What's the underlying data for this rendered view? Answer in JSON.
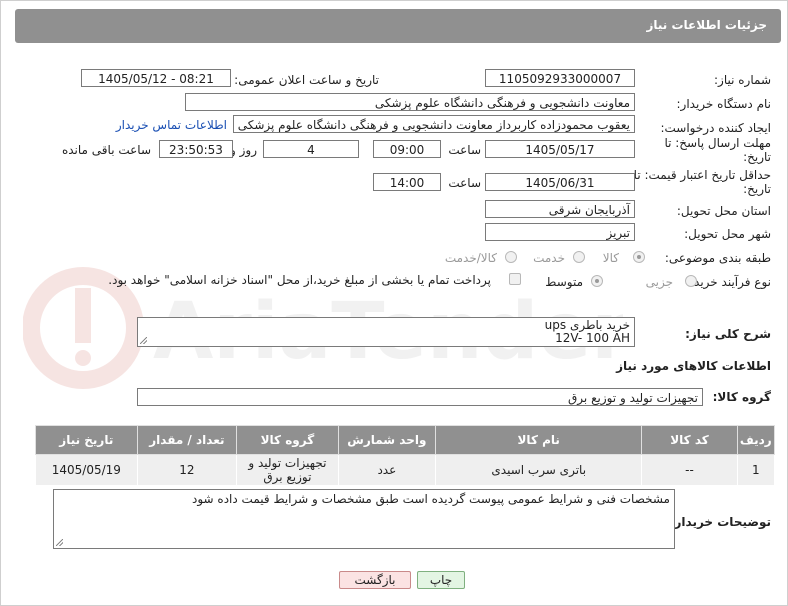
{
  "header": {
    "title": "جزئیات اطلاعات نیاز"
  },
  "form": {
    "need_number_label": "شماره نیاز:",
    "need_number_value": "1105092933000007",
    "announce_label": "تاریخ و ساعت اعلان عمومی:",
    "announce_value": "1405/05/12 - 08:21",
    "buyer_org_label": "نام دستگاه خریدار:",
    "buyer_org_value": "معاونت دانشجویی و فرهنگی دانشگاه علوم پزشکی",
    "creator_label": "ایجاد کننده درخواست:",
    "creator_value": "یعقوب محمودزاده کاربرداز معاونت دانشجویی و فرهنگی دانشگاه علوم پزشکی",
    "contact_link": "اطلاعات تماس خریدار",
    "reply_deadline_label": "مهلت ارسال پاسخ: تا تاریخ:",
    "reply_date": "1405/05/17",
    "time_label": "ساعت",
    "reply_time": "09:00",
    "days_value": "4",
    "days_label": "روز و",
    "remaining_value": "23:50:53",
    "remaining_label": "ساعت باقی مانده",
    "price_validity_label": "حداقل تاریخ اعتبار قیمت: تا تاریخ:",
    "price_date": "1405/06/31",
    "price_time": "14:00",
    "province_label": "استان محل تحویل:",
    "province_value": "آذربایجان شرقی",
    "city_label": "شهر محل تحویل:",
    "city_value": "تبریز",
    "category_label": "طبقه بندی موضوعی:",
    "category_options": [
      "کالا",
      "خدمت",
      "کالا/خدمت"
    ],
    "process_label": "نوع فرآیند خرید :",
    "process_options": [
      "جزیی",
      "متوسط"
    ],
    "payment_note": "پرداخت تمام یا بخشی از مبلغ خرید،از محل \"اسناد خزانه اسلامی\" خواهد بود."
  },
  "description": {
    "label": "شرح کلی نیاز:",
    "line1": "خرید باطری ups",
    "line2": "12V- 100 AH"
  },
  "goods_info_title": "اطلاعات کالاهای مورد نیاز",
  "goods_group": {
    "label": "گروه کالا:",
    "value": "تجهیزات تولید و توزیع برق"
  },
  "table": {
    "headers": [
      "ردیف",
      "کد کالا",
      "نام کالا",
      "واحد شمارش",
      "گروه کالا",
      "تعداد / مقدار",
      "تاریخ نیاز"
    ],
    "rows": [
      [
        "1",
        "--",
        "باتری سرب اسیدی",
        "عدد",
        "تجهیزات تولید و توزیع برق",
        "12",
        "1405/05/19"
      ]
    ]
  },
  "buyer_notes": {
    "label": "توضیحات خریدار:",
    "value": "مشخصات فنی و شرایط عمومی پیوست گردیده است طبق مشخصات و شرایط قیمت داده شود"
  },
  "buttons": {
    "print": "چاپ",
    "back": "بازگشت"
  },
  "watermark_text": "AriaTender.neT",
  "colors": {
    "header_bg": "#909090",
    "link": "#1a4fb3",
    "back_btn_bg": "#fbe3e3",
    "print_btn_bg": "#e3f5e3",
    "watermark": "#c0392b"
  }
}
